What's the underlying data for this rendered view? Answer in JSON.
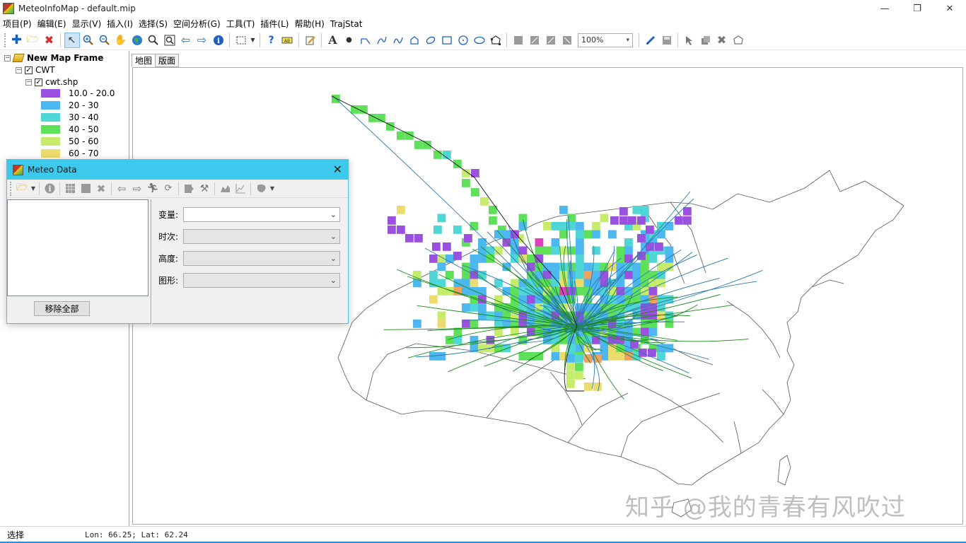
{
  "window": {
    "title": "MeteoInfoMap - default.mip",
    "controls": {
      "minimize": "—",
      "restore": "❐",
      "close": "✕"
    }
  },
  "menu": [
    "项目(P)",
    "编辑(E)",
    "显示(V)",
    "插入(I)",
    "选择(S)",
    "空间分析(G)",
    "工具(T)",
    "插件(L)",
    "帮助(H)",
    "TrajStat"
  ],
  "toolbar": {
    "zoom_value": "100%"
  },
  "tree": {
    "frame_label": "New Map Frame",
    "group_label": "CWT",
    "layer_label": "cwt.shp",
    "legend": [
      {
        "label": "10.0 - 20.0",
        "color": "#9b51e0"
      },
      {
        "label": "20 - 30",
        "color": "#4db8f0"
      },
      {
        "label": "30 - 40",
        "color": "#4fd6d6"
      },
      {
        "label": "40 - 50",
        "color": "#5fe05a"
      },
      {
        "label": "50 - 60",
        "color": "#c7ec6b"
      },
      {
        "label": "60 - 70",
        "color": "#ecdc6e"
      }
    ]
  },
  "map": {
    "tabs": [
      "地图",
      "版面"
    ]
  },
  "watermark": "知乎 @我的青春有风吹过",
  "status": {
    "mode": "选择",
    "coords": "Lon: 66.25; Lat: 62.24"
  },
  "dialog": {
    "title": "Meteo Data",
    "close": "✕",
    "remove_all": "移除全部",
    "fields": [
      {
        "label": "变量:",
        "value": ""
      },
      {
        "label": "时次:",
        "value": ""
      },
      {
        "label": "高度:",
        "value": ""
      },
      {
        "label": "图形:",
        "value": ""
      }
    ]
  },
  "colors": {
    "accent": "#3dc9ec",
    "purple": "#9b51e0",
    "blue": "#4db8f0",
    "cyan": "#4fd6d6",
    "green": "#5fe05a",
    "lime": "#c7ec6b",
    "yellow": "#ecdc6e",
    "orange": "#f0a060",
    "magenta": "#e040c0",
    "trajectory": "#1a8a1a",
    "trajectory_blue": "#2a7ab0"
  }
}
